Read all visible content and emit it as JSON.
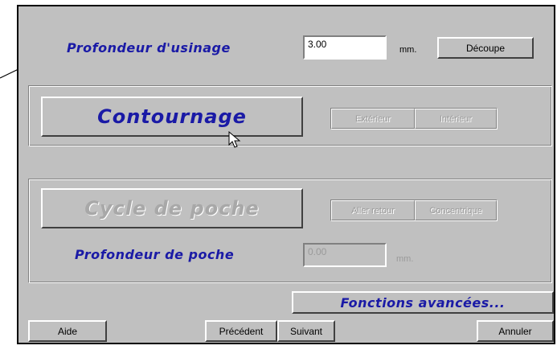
{
  "depth": {
    "label": "Profondeur d'usinage",
    "value": "3.00",
    "unit": "mm.",
    "cut_button": "Découpe"
  },
  "contour": {
    "button": "Contournage",
    "options": [
      "Extérieur",
      "Intérieur"
    ]
  },
  "pocket": {
    "button": "Cycle de poche",
    "options": [
      "Aller retour",
      "Concentrique"
    ],
    "depth_label": "Profondeur de poche",
    "depth_value": "0.00",
    "depth_unit": "mm."
  },
  "advanced_button": "Fonctions avancées...",
  "footer": {
    "help": "Aide",
    "previous": "Précédent",
    "next": "Suivant",
    "cancel": "Annuler"
  },
  "colors": {
    "face": "#c0c0c0",
    "accent_text": "#1a1aa6",
    "disabled_text": "#9a9a9a"
  }
}
